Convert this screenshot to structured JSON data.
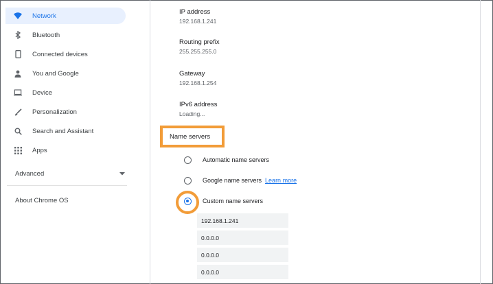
{
  "sidebar": {
    "items": [
      {
        "label": "Network",
        "icon": "wifi-icon",
        "active": true
      },
      {
        "label": "Bluetooth",
        "icon": "bluetooth-icon"
      },
      {
        "label": "Connected devices",
        "icon": "phone-icon"
      },
      {
        "label": "You and Google",
        "icon": "person-icon"
      },
      {
        "label": "Device",
        "icon": "laptop-icon"
      },
      {
        "label": "Personalization",
        "icon": "brush-icon"
      },
      {
        "label": "Search and Assistant",
        "icon": "search-icon"
      },
      {
        "label": "Apps",
        "icon": "apps-grid-icon"
      }
    ],
    "advanced": "Advanced",
    "about": "About Chrome OS"
  },
  "network": {
    "ip_label": "IP address",
    "ip_value": "192.168.1.241",
    "prefix_label": "Routing prefix",
    "prefix_value": "255.255.255.0",
    "gateway_label": "Gateway",
    "gateway_value": "192.168.1.254",
    "ipv6_label": "IPv6 address",
    "ipv6_value": "Loading..."
  },
  "name_servers": {
    "title": "Name servers",
    "options": [
      {
        "label": "Automatic name servers",
        "checked": false
      },
      {
        "label": "Google name servers",
        "checked": false,
        "link": "Learn more"
      },
      {
        "label": "Custom name servers",
        "checked": true
      }
    ],
    "custom_values": [
      "192.168.1.241",
      "0.0.0.0",
      "0.0.0.0",
      "0.0.0.0"
    ]
  },
  "colors": {
    "accent": "#1a73e8",
    "highlight": "#f29c38",
    "active_bg": "#e8f0fe"
  }
}
